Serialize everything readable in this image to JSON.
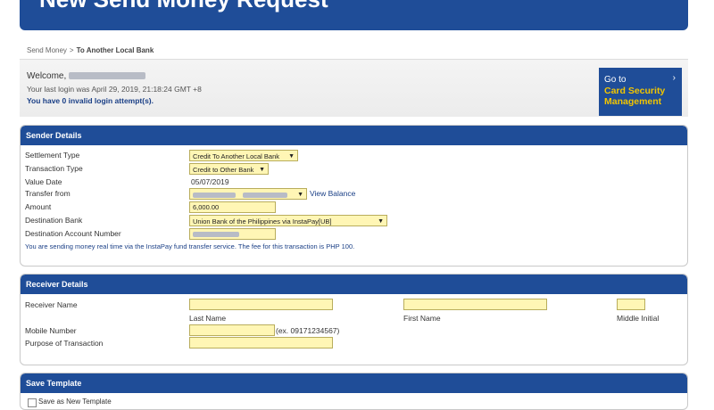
{
  "header": {
    "title": "New Send Money Request"
  },
  "breadcrumb": {
    "parent": "Send Money",
    "separator": ">",
    "current": "To Another Local Bank"
  },
  "welcome": {
    "greeting": "Welcome,",
    "last_login": "Your last login was April 29, 2019, 21:18:24 GMT +8",
    "invalid_attempts": "You have 0 invalid login attempt(s)."
  },
  "card_security": {
    "line1": "Go to",
    "line2": "Card Security",
    "line3": "Management",
    "chevron": "›"
  },
  "sender": {
    "title": "Sender Details",
    "settlement_label": "Settlement Type",
    "settlement_value": "Credit To Another Local Bank",
    "transaction_label": "Transaction Type",
    "transaction_value": "Credit to Other Bank",
    "value_date_label": "Value Date",
    "value_date": "05/07/2019",
    "transfer_from_label": "Transfer from",
    "view_balance": "View Balance",
    "amount_label": "Amount",
    "amount": "6,000.00",
    "dest_bank_label": "Destination Bank",
    "dest_bank": "Union Bank of the Philippines via InstaPay[UB]",
    "dest_account_label": "Destination Account Number",
    "note": "You are sending money real time via the InstaPay fund transfer service. The fee for this transaction is PHP 100."
  },
  "receiver": {
    "title": "Receiver Details",
    "name_label": "Receiver Name",
    "last_name": "Last Name",
    "first_name": "First Name",
    "middle_initial": "Middle Initial",
    "mobile_label": "Mobile Number",
    "mobile_hint": "(ex. 09171234567)",
    "purpose_label": "Purpose of Transaction"
  },
  "template": {
    "title": "Save Template",
    "checkbox_label": "Save as New Template"
  },
  "colors": {
    "brand_blue": "#1f4d98",
    "field_yellow": "#fff6b5",
    "accent_yellow": "#f2c500"
  },
  "icons": {
    "dropdown": "chevron-down-icon",
    "card_chevron": "chevron-right-icon"
  }
}
